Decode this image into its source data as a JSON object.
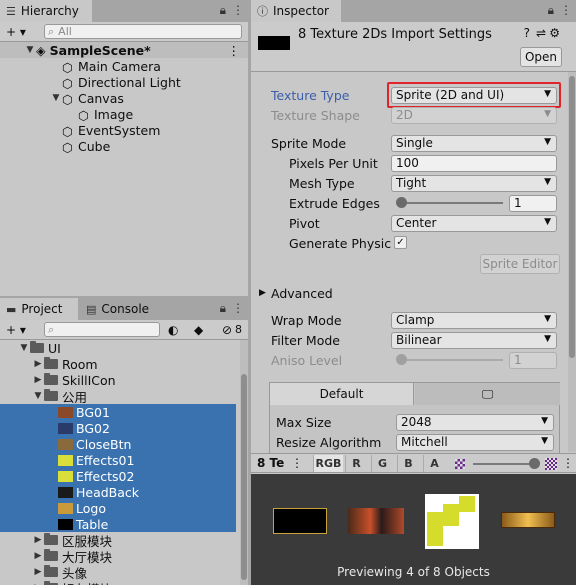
{
  "hierarchy": {
    "tab_label": "Hierarchy",
    "add_label": "+ ▾",
    "search_placeholder": "All",
    "scene_name": "SampleScene*",
    "items": [
      {
        "label": "Main Camera"
      },
      {
        "label": "Directional Light"
      },
      {
        "label": "Canvas"
      },
      {
        "label": "Image"
      },
      {
        "label": "EventSystem"
      },
      {
        "label": "Cube"
      }
    ]
  },
  "project": {
    "tab_label": "Project",
    "console_tab_label": "Console",
    "add_label": "+ ▾",
    "hidden_count": "8",
    "tree": [
      {
        "label": "UI",
        "depth": 0,
        "expanded": true,
        "kind": "folder"
      },
      {
        "label": "Room",
        "depth": 1,
        "kind": "folder"
      },
      {
        "label": "SkillICon",
        "depth": 1,
        "kind": "folder"
      },
      {
        "label": "公用",
        "depth": 1,
        "expanded": true,
        "kind": "folder"
      },
      {
        "label": "BG01",
        "depth": 2,
        "kind": "texture",
        "selected": true,
        "thumb_color": "#8a4a2a"
      },
      {
        "label": "BG02",
        "depth": 2,
        "kind": "texture",
        "selected": true,
        "thumb_color": "#2a3a6a"
      },
      {
        "label": "CloseBtn",
        "depth": 2,
        "kind": "texture",
        "selected": true,
        "thumb_color": "#8a6a3a"
      },
      {
        "label": "Effects01",
        "depth": 2,
        "kind": "texture",
        "selected": true,
        "thumb_color": "#d8de3a"
      },
      {
        "label": "Effects02",
        "depth": 2,
        "kind": "texture",
        "selected": true,
        "thumb_color": "#d8de3a"
      },
      {
        "label": "HeadBack",
        "depth": 2,
        "kind": "texture",
        "selected": true,
        "thumb_color": "#1a1a1a"
      },
      {
        "label": "Logo",
        "depth": 2,
        "kind": "texture",
        "selected": true,
        "thumb_color": "#c89a3a"
      },
      {
        "label": "Table",
        "depth": 2,
        "kind": "texture",
        "selected": true,
        "thumb_color": "#000000"
      },
      {
        "label": "区服模块",
        "depth": 1,
        "kind": "folder"
      },
      {
        "label": "大厅模块",
        "depth": 1,
        "kind": "folder"
      },
      {
        "label": "头像",
        "depth": 1,
        "kind": "folder"
      },
      {
        "label": "好友模块",
        "depth": 1,
        "kind": "folder"
      }
    ]
  },
  "inspector": {
    "tab_label": "Inspector",
    "header_title": "8 Texture 2Ds Import Settings",
    "open_button": "Open",
    "texture_type": {
      "label": "Texture Type",
      "value": "Sprite (2D and UI)"
    },
    "texture_shape": {
      "label": "Texture Shape",
      "value": "2D"
    },
    "sprite_mode": {
      "label": "Sprite Mode",
      "value": "Single"
    },
    "pixels_per_unit": {
      "label": "Pixels Per Unit",
      "value": "100"
    },
    "mesh_type": {
      "label": "Mesh Type",
      "value": "Tight"
    },
    "extrude_edges": {
      "label": "Extrude Edges",
      "value": "1"
    },
    "pivot": {
      "label": "Pivot",
      "value": "Center"
    },
    "generate_physics": {
      "label": "Generate Physics S",
      "checked": true
    },
    "sprite_editor_button": "Sprite Editor",
    "advanced_label": "Advanced",
    "wrap_mode": {
      "label": "Wrap Mode",
      "value": "Clamp"
    },
    "filter_mode": {
      "label": "Filter Mode",
      "value": "Bilinear"
    },
    "aniso_level": {
      "label": "Aniso Level",
      "value": "1"
    },
    "platform_tab_default": "Default",
    "max_size": {
      "label": "Max Size",
      "value": "2048"
    },
    "resize_algorithm": {
      "label": "Resize Algorithm",
      "value": "Mitchell"
    },
    "highlight_color": "#e0242a"
  },
  "preview": {
    "title": "8 Te",
    "channels": [
      "RGB",
      "R",
      "G",
      "B",
      "A"
    ],
    "caption": "Previewing 4 of 8 Objects"
  }
}
